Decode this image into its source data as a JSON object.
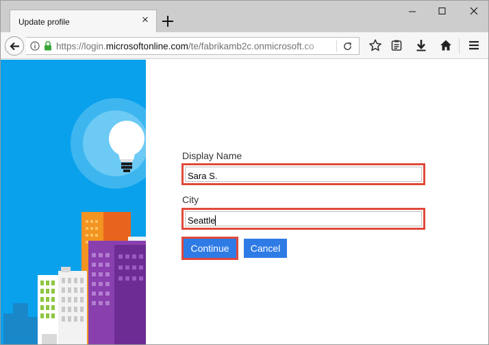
{
  "browser": {
    "tab_title": "Update profile",
    "url_prefix": "https://login.",
    "url_host": "microsoftonline.com",
    "url_path": "/te/fabrikamb2c.onmicrosoft.co",
    "icons": {
      "tab_close": "close-icon",
      "new_tab": "plus-icon",
      "minimize": "minimize-icon",
      "maximize": "maximize-icon",
      "close": "close-icon",
      "back": "back-arrow-icon",
      "info": "info-icon",
      "lock": "lock-icon",
      "reload": "reload-icon",
      "bookmark": "star-icon",
      "reading_list": "clipboard-icon",
      "downloads": "download-icon",
      "home": "home-icon",
      "menu": "hamburger-menu-icon"
    }
  },
  "form": {
    "display_name_label": "Display Name",
    "display_name_value": "Sara S.",
    "city_label": "City",
    "city_value": "Seattle",
    "continue_label": "Continue",
    "cancel_label": "Cancel"
  },
  "colors": {
    "highlight": "#e0493a",
    "button": "#2f7be6",
    "sky": "#0aa1ec"
  }
}
